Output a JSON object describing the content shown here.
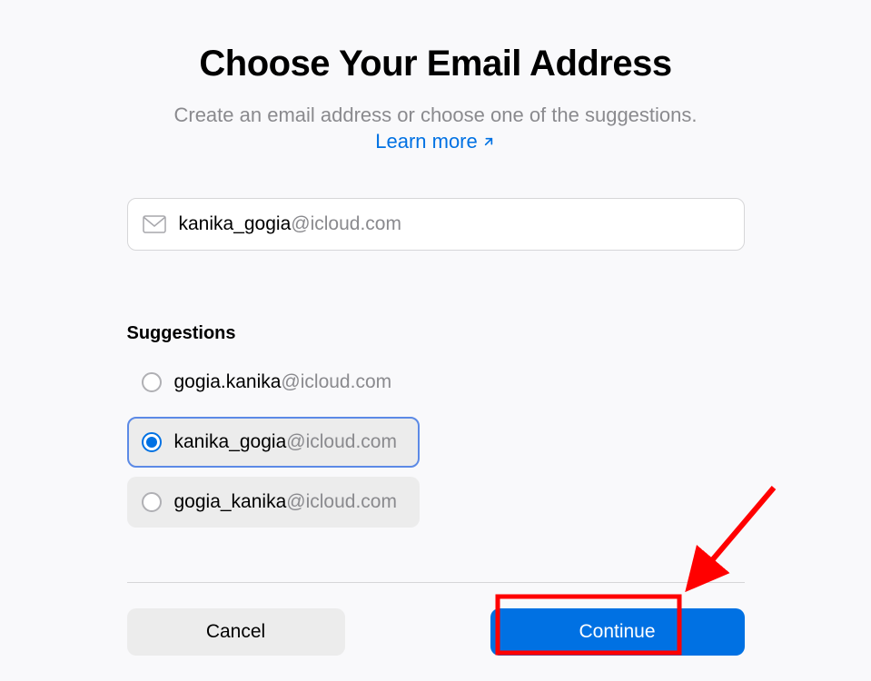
{
  "header": {
    "title": "Choose Your Email Address",
    "subtitle": "Create an email address or choose one of the suggestions.",
    "learn_more_label": "Learn more"
  },
  "email_field": {
    "local": "kanika_gogia",
    "domain": "@icloud.com"
  },
  "suggestions": {
    "heading": "Suggestions",
    "items": [
      {
        "local": "gogia.kanika",
        "domain": "@icloud.com",
        "selected": false,
        "alt": false
      },
      {
        "local": "kanika_gogia",
        "domain": "@icloud.com",
        "selected": true,
        "alt": false
      },
      {
        "local": "gogia_kanika",
        "domain": "@icloud.com",
        "selected": false,
        "alt": true
      }
    ]
  },
  "footer": {
    "cancel_label": "Cancel",
    "continue_label": "Continue"
  },
  "colors": {
    "accent": "#0071e3",
    "highlight_box": "#ff0000"
  }
}
